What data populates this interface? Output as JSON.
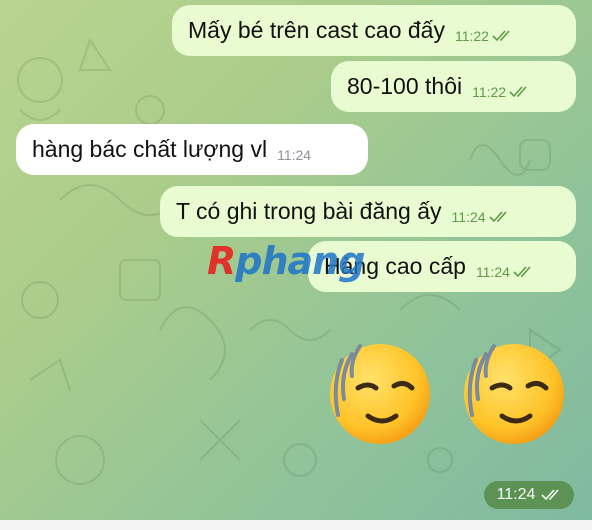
{
  "messages": [
    {
      "text": "Mấy bé trên cast cao đấy",
      "time": "11:22",
      "direction": "outgoing"
    },
    {
      "text": "80-100 thôi",
      "time": "11:22",
      "direction": "outgoing"
    },
    {
      "text": "hàng bác chất lượng vl",
      "time": "11:24",
      "direction": "incoming"
    },
    {
      "text": "T có ghi trong bài đăng ấy",
      "time": "11:24",
      "direction": "outgoing"
    },
    {
      "text": "Hàng cao cấp",
      "time": "11:24",
      "direction": "outgoing"
    }
  ],
  "sticker_message": {
    "emojis": [
      "relieved-face-sweat-emoji",
      "relieved-face-sweat-emoji"
    ],
    "time": "11:24"
  },
  "watermark": {
    "first": "R",
    "rest": "phang"
  },
  "colors": {
    "outgoing_bubble": "#e9fbd0",
    "incoming_bubble": "#ffffff",
    "time_green": "#5f9a4a",
    "time_pill": "#5a8f4f"
  }
}
